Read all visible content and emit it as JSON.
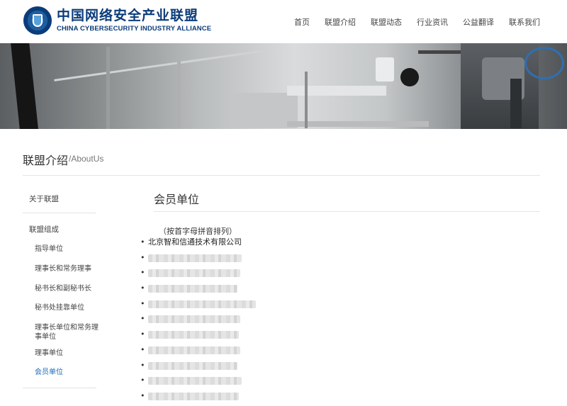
{
  "header": {
    "logo_cn": "中国网络安全产业联盟",
    "logo_en": "CHINA CYBERSECURITY INDUSTRY ALLIANCE",
    "nav": [
      "首页",
      "联盟介绍",
      "联盟动态",
      "行业资讯",
      "公益翻译",
      "联系我们"
    ]
  },
  "section": {
    "title": "联盟介绍",
    "subtitle": "/AboutUs"
  },
  "sidebar": {
    "top": "关于联盟",
    "group": "联盟组成",
    "items": [
      "指导单位",
      "理事长和常务理事",
      "秘书长和副秘书长",
      "秘书处挂靠单位",
      "理事长单位和常务理事单位",
      "理事单位",
      "会员单位"
    ],
    "active_index": 6
  },
  "content": {
    "title": "会员单位",
    "note": "（按首字母拼音排列）",
    "members": [
      "北京智和信通技术有限公司",
      "",
      "",
      "",
      "",
      "",
      "",
      "",
      "",
      "",
      ""
    ]
  },
  "colors": {
    "brand": "#0b3c7a",
    "active": "#1c6bb8",
    "divider": "#e5e5e5"
  }
}
